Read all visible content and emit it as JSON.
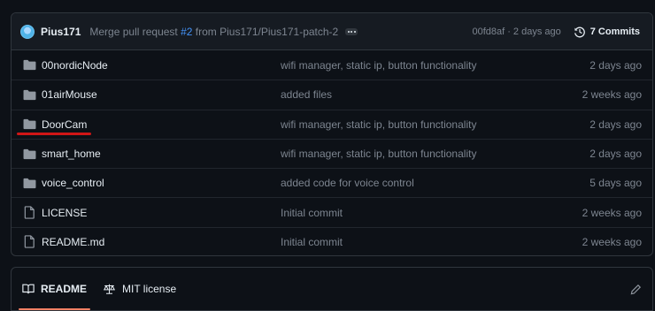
{
  "latest_commit": {
    "author": "Pius171",
    "message_prefix": "Merge pull request ",
    "pr_ref": "#2",
    "message_suffix": " from Pius171/Pius171-patch-2",
    "sha_time": "00fd8af · 2 days ago",
    "commits_count_label": "7 Commits"
  },
  "files": [
    {
      "name": "00nordicNode",
      "type": "folder",
      "message": "wifi manager, static ip, button functionality",
      "time": "2 days ago"
    },
    {
      "name": "01airMouse",
      "type": "folder",
      "message": "added files",
      "time": "2 weeks ago"
    },
    {
      "name": "DoorCam",
      "type": "folder",
      "message": "wifi manager, static ip, button functionality",
      "time": "2 days ago",
      "highlighted": true
    },
    {
      "name": "smart_home",
      "type": "folder",
      "message": "wifi manager, static ip, button functionality",
      "time": "2 days ago"
    },
    {
      "name": "voice_control",
      "type": "folder",
      "message": "added code for voice control",
      "time": "5 days ago"
    },
    {
      "name": "LICENSE",
      "type": "file",
      "message": "Initial commit",
      "time": "2 weeks ago"
    },
    {
      "name": "README.md",
      "type": "file",
      "message": "Initial commit",
      "time": "2 weeks ago"
    }
  ],
  "readme_tabs": {
    "readme_label": "README",
    "license_label": "MIT license"
  },
  "colors": {
    "background": "#0d1117",
    "muted_text": "#7d8590",
    "link": "#4493f8",
    "active_tab_underline": "#f78166",
    "annotation_red": "#d01616"
  }
}
